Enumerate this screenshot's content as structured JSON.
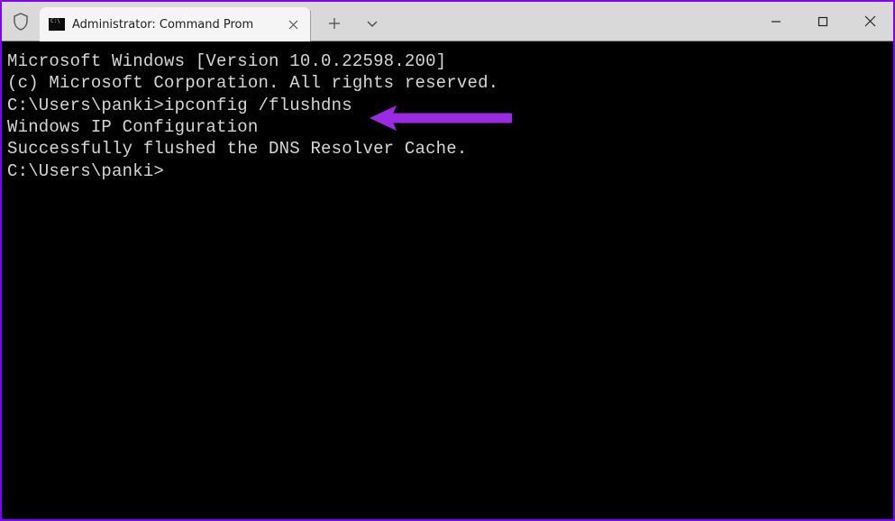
{
  "window": {
    "tab_title": "Administrator: Command Prom"
  },
  "terminal": {
    "line1": "Microsoft Windows [Version 10.0.22598.200]",
    "line2": "(c) Microsoft Corporation. All rights reserved.",
    "blank1": "",
    "prompt1": "C:\\Users\\panki>",
    "command1": "ipconfig /flushdns",
    "blank2": "",
    "heading": "Windows IP Configuration",
    "blank3": "",
    "success": "Successfully flushed the DNS Resolver Cache.",
    "blank4": "",
    "prompt2": "C:\\Users\\panki>"
  },
  "annotation": {
    "arrow_color": "#9a2be2"
  }
}
